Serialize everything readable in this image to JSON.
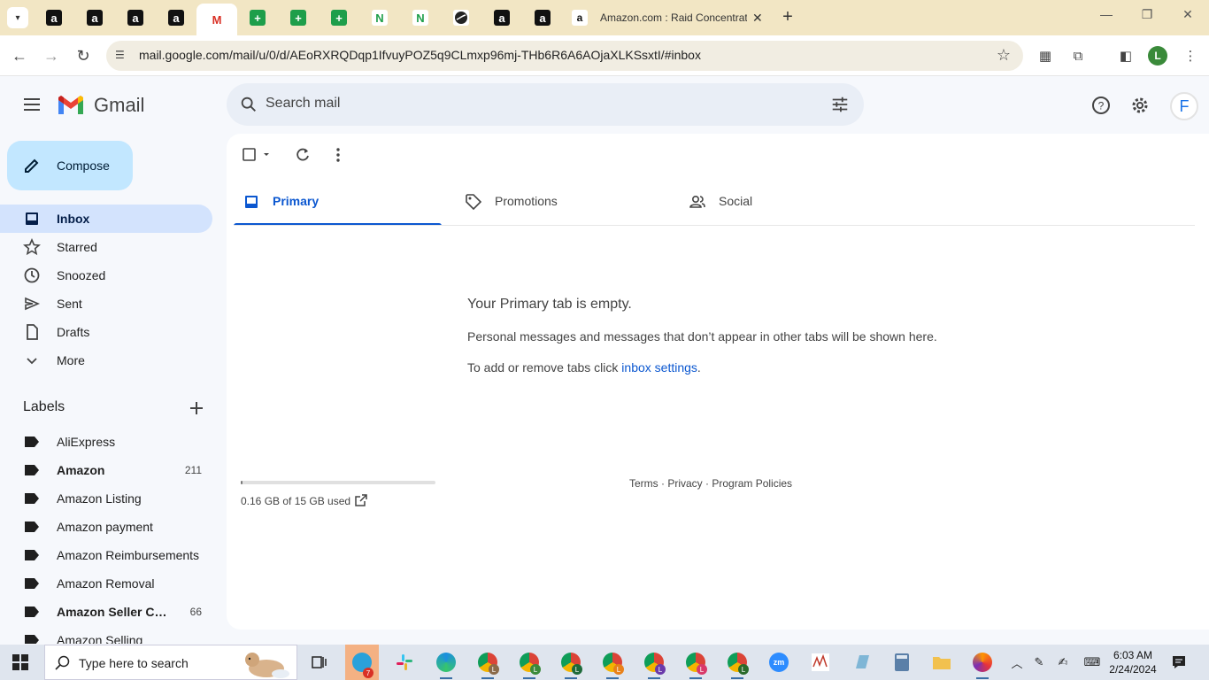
{
  "browser": {
    "tabs": [
      {
        "favicon": "amazon"
      },
      {
        "favicon": "amazon"
      },
      {
        "favicon": "amazon"
      },
      {
        "favicon": "amazon"
      },
      {
        "favicon": "gmail",
        "active": true
      },
      {
        "favicon": "sheets"
      },
      {
        "favicon": "sheets"
      },
      {
        "favicon": "sheets"
      },
      {
        "favicon": "n"
      },
      {
        "favicon": "n"
      },
      {
        "favicon": "globe"
      },
      {
        "favicon": "amazon"
      },
      {
        "favicon": "amazon"
      }
    ],
    "long_tab_title": "Amazon.com : Raid Concentrate",
    "url": "mail.google.com/mail/u/0/d/AEoRXRQDqp1IfvuyPOZ5q9CLmxp96mj-THb6R6A6AOjaXLKSsxtI/#inbox",
    "profile_initial": "L"
  },
  "gmail": {
    "app_name": "Gmail",
    "search_placeholder": "Search mail",
    "account_initial": "F",
    "compose_label": "Compose",
    "nav": [
      {
        "label": "Inbox",
        "icon": "inbox-icon",
        "active": true
      },
      {
        "label": "Starred",
        "icon": "star-icon"
      },
      {
        "label": "Snoozed",
        "icon": "clock-icon"
      },
      {
        "label": "Sent",
        "icon": "send-icon"
      },
      {
        "label": "Drafts",
        "icon": "draft-icon"
      },
      {
        "label": "More",
        "icon": "chevron-down-icon"
      }
    ],
    "labels_title": "Labels",
    "labels": [
      {
        "label": "AliExpress",
        "count": ""
      },
      {
        "label": "Amazon",
        "count": "211",
        "bold": true
      },
      {
        "label": "Amazon Listing",
        "count": ""
      },
      {
        "label": "Amazon payment",
        "count": ""
      },
      {
        "label": "Amazon Reimbursements",
        "count": ""
      },
      {
        "label": "Amazon Removal",
        "count": ""
      },
      {
        "label": "Amazon Seller Central",
        "count": "66",
        "bold": true
      },
      {
        "label": "Amazon Selling",
        "count": ""
      }
    ],
    "tabs": [
      {
        "label": "Primary",
        "active": true
      },
      {
        "label": "Promotions"
      },
      {
        "label": "Social"
      }
    ],
    "empty": {
      "title": "Your Primary tab is empty.",
      "description": "Personal messages and messages that don’t appear in other tabs will be shown here.",
      "hint_prefix": "To add or remove tabs click ",
      "hint_link": "inbox settings",
      "hint_suffix": "."
    },
    "storage": {
      "text": "0.16 GB of 15 GB used",
      "fraction_used": 0.011
    },
    "footer": {
      "terms": "Terms",
      "privacy": "Privacy",
      "policies": "Program Policies",
      "separator": " · "
    }
  },
  "taskbar": {
    "search_placeholder": "Type here to search",
    "telegram_badge": "7",
    "time": "6:03 AM",
    "date": "2/24/2024"
  }
}
